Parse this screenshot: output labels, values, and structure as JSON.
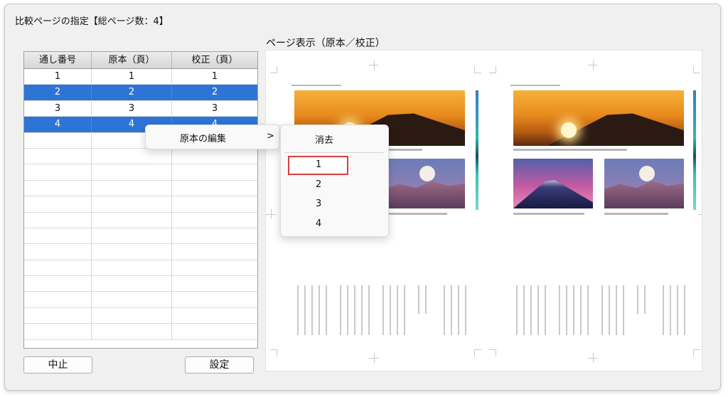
{
  "window": {
    "title": "比較ページの指定【総ページ数：4】"
  },
  "preview": {
    "label": "ページ表示（原本／校正）"
  },
  "table": {
    "headers": [
      "通し番号",
      "原本（頁）",
      "校正（頁）"
    ],
    "rows": [
      {
        "serial": "1",
        "original": "1",
        "proof": "1",
        "selected": false
      },
      {
        "serial": "2",
        "original": "2",
        "proof": "2",
        "selected": true
      },
      {
        "serial": "3",
        "original": "3",
        "proof": "3",
        "selected": false
      },
      {
        "serial": "4",
        "original": "4",
        "proof": "4",
        "selected": true
      }
    ],
    "empty_rows": 13
  },
  "buttons": {
    "cancel": "中止",
    "apply": "設定"
  },
  "context_menu": {
    "item": "原本の編集",
    "chevron": ">",
    "submenu": {
      "clear": "消去",
      "pages": [
        "1",
        "2",
        "3",
        "4"
      ],
      "highlighted": "1"
    }
  },
  "colors": {
    "selection": "#2d74d6",
    "highlight_border": "#d64141"
  }
}
